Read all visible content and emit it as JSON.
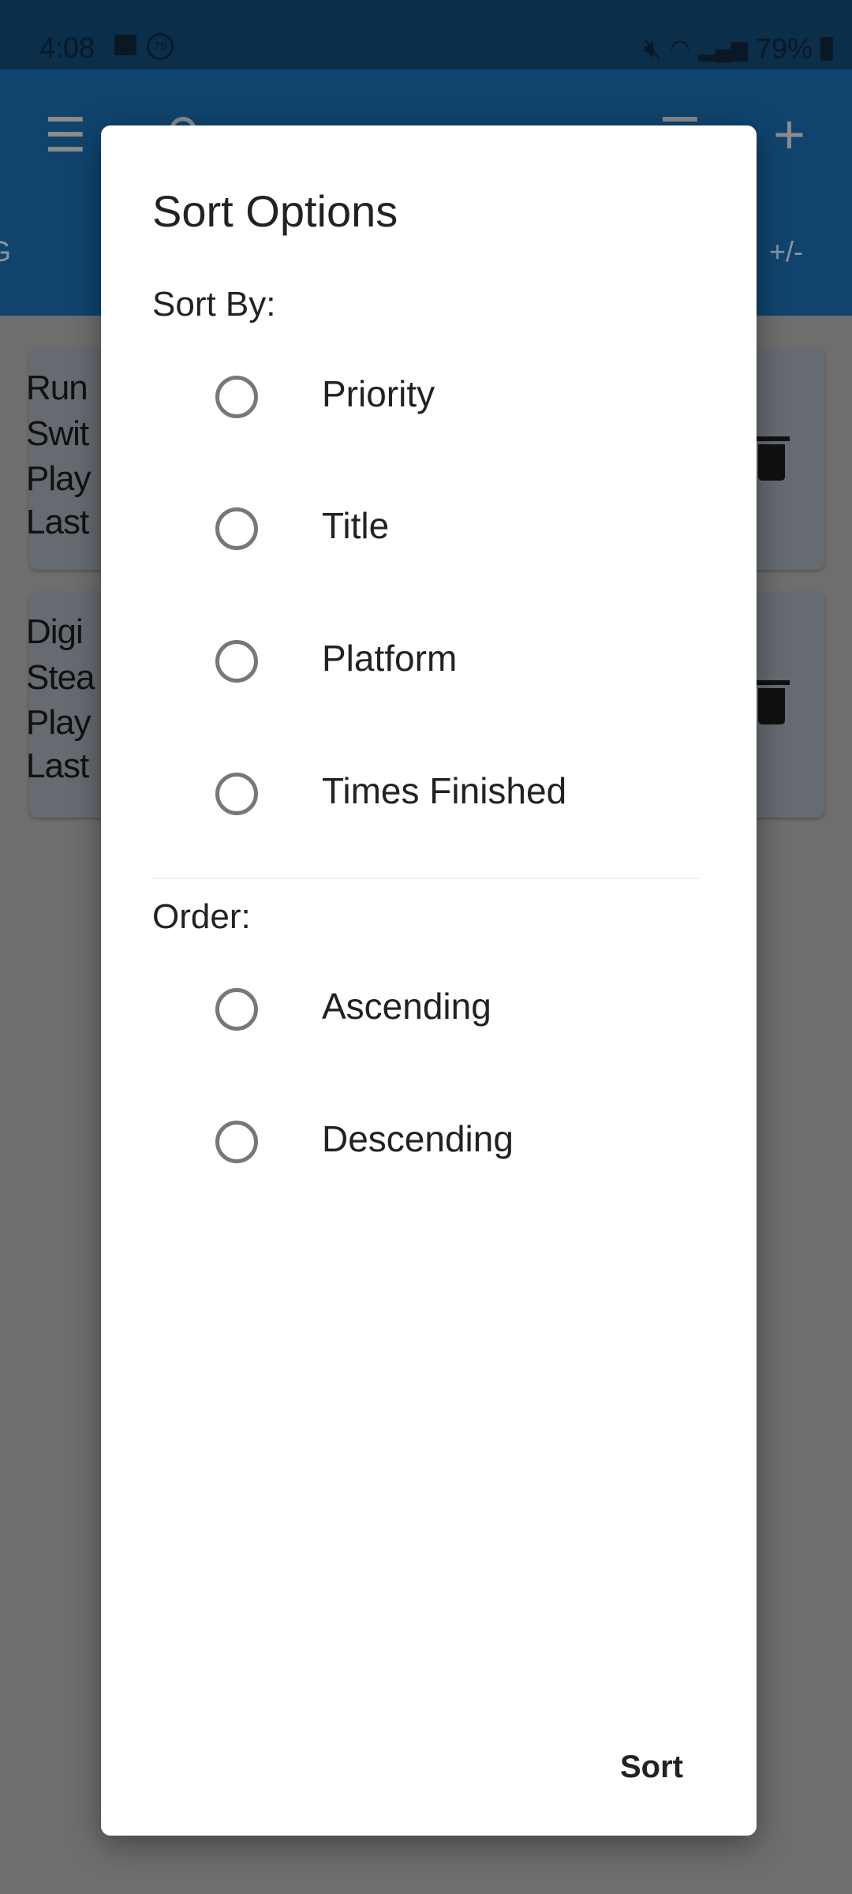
{
  "status_bar": {
    "time": "4:08",
    "battery": "79%",
    "notification_badge": "79"
  },
  "app_bar": {
    "icons": [
      "menu-icon",
      "search-icon",
      "filter-icon",
      "plus-icon"
    ],
    "tabs": [
      "G",
      "+/-"
    ]
  },
  "cards": [
    {
      "lines": [
        "Run",
        "Swit",
        "Play",
        "Last"
      ]
    },
    {
      "lines": [
        "Digi",
        "Stea",
        "Play",
        "Last"
      ]
    }
  ],
  "dialog": {
    "title": "Sort Options",
    "sort_by_label": "Sort By:",
    "sort_by_options": [
      "Priority",
      "Title",
      "Platform",
      "Times Finished"
    ],
    "order_label": "Order:",
    "order_options": [
      "Ascending",
      "Descending"
    ],
    "sort_button": "Sort"
  }
}
